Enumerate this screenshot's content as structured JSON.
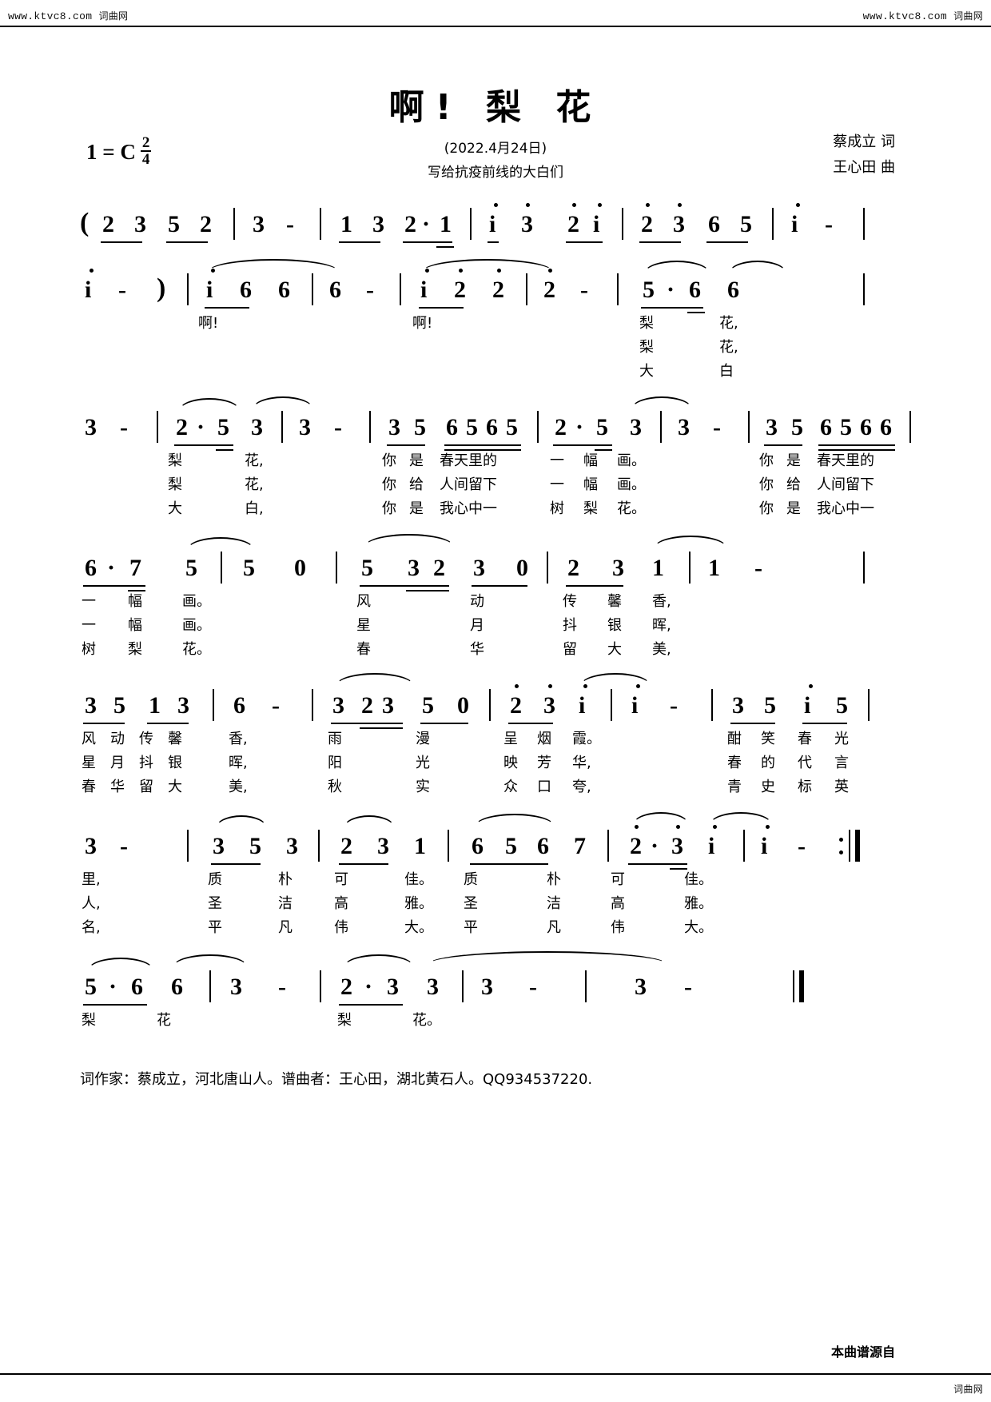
{
  "watermark": {
    "url_left": "www.ktvc8.com",
    "site_left": "词曲网",
    "url_right": "www.ktvc8.com",
    "site_right": "词曲网",
    "bottom_left_url": "",
    "bottom_right": "词曲网"
  },
  "header": {
    "title": "啊! 梨 花",
    "key_label": "1 = C",
    "time_num": "2",
    "time_den": "4",
    "date_line": "(2022.4月24日)",
    "dedication": "写给抗疫前线的大白们",
    "lyricist": "蔡成立 词",
    "composer": "王心田 曲"
  },
  "chart_data": {
    "type": "table",
    "title": "啊! 梨 花 — 简谱 (Numbered Musical Notation)",
    "key": "1 = C",
    "time_signature": "2/4",
    "systems": [
      {
        "index": 1,
        "notes": "( 2 3 5 2 | 3 - | 1 3 2·1 | i 3 2i | 2 3 6 5 | i -",
        "lyrics": []
      },
      {
        "index": 2,
        "notes": "i - ) | i 6 6 | 6 - | i 2 2 | 2 - | 5·6 6",
        "lyrics": [
          "啊!            啊!                   梨      花,",
          "                                      梨      花,",
          "                                      大      白"
        ]
      },
      {
        "index": 3,
        "notes": "3 - | 2·5 3 | 3 - | 3 5 6565 | 2·5 3 | 3 - | 3 5 6566",
        "lyrics": [
          "梨   花,      你 是 春天里的  一 幅 画。      你 是 春天里的",
          "梨   花,      你 给 人间留下  一 幅 画。      你 给 人间留下",
          "大   白,      你 是 我心中一  树 梨 花。      你 是 我心中一"
        ]
      },
      {
        "index": 4,
        "notes": "6·7 5 | 5 0 | 5 32 3 0 | 2 3 1 | 1 -",
        "lyrics": [
          "一 幅 画。      风      动     传 馨 香,",
          "一 幅 画。      星      月     抖 银 晖,",
          "树 梨 花。      春      华     留 大 美,"
        ]
      },
      {
        "index": 5,
        "notes": "3 5 1 3 | 6 - | 3 23 5 0 | 2 3 i | i - | 3 5 i 5",
        "lyrics": [
          "风 动 传 馨 香,   雨   漫   呈 烟 霞。   酣 笑 春 光",
          "星 月 抖 银 晖,   阳   光   映 芳 华,   春 的 代 言",
          "春 华 留 大 美,   秋   实   众 口 夸,   青 史 标 英"
        ]
      },
      {
        "index": 6,
        "notes": "3 - | 3 5 3 | 2 3 1 | 6 5 6 7 | 2·3 i | i - :|",
        "lyrics": [
          "里,   质 朴 可 佳。 质 朴 可 佳。",
          "人,   圣 洁 高 雅。 圣 洁 高 雅。",
          "名,   平 凡 伟 大。 平 凡 伟 大。"
        ]
      },
      {
        "index": 7,
        "notes": "5·6 6 | 3 - | 2·3 3 | 3 - | 3 - ||",
        "lyrics": [
          "梨   花     梨   花。"
        ]
      }
    ]
  },
  "sys1": {
    "n": [
      "(",
      "2",
      "3",
      "5",
      "2",
      "3",
      "-",
      "1",
      "3",
      "2",
      "·",
      "1",
      "i",
      "3",
      "2",
      "i",
      "2",
      "3",
      "6",
      "5",
      "i",
      "-"
    ]
  },
  "sys2": {
    "n": [
      "i",
      "-",
      ")",
      "i",
      "6",
      "6",
      "6",
      "-",
      "i",
      "2",
      "2",
      "2",
      "-",
      "5",
      "·",
      "6",
      "6"
    ],
    "lyr1": [
      "啊!",
      "啊!",
      "梨",
      "花,"
    ],
    "lyr2": [
      "梨",
      "花,"
    ],
    "lyr3": [
      "大",
      "白"
    ]
  },
  "sys3": {
    "n": [
      "3",
      "-",
      "2",
      "·",
      "5",
      "3",
      "3",
      "-",
      "3",
      "5",
      "6",
      "5",
      "6",
      "5",
      "2",
      "·",
      "5",
      "3",
      "3",
      "-",
      "3",
      "5",
      "6",
      "5",
      "6",
      "6"
    ],
    "lyr1": [
      "梨",
      "花,",
      "你",
      "是",
      "春天里的",
      "一",
      "幅",
      "画。",
      "你",
      "是",
      "春天里的"
    ],
    "lyr2": [
      "梨",
      "花,",
      "你",
      "给",
      "人间留下",
      "一",
      "幅",
      "画。",
      "你",
      "给",
      "人间留下"
    ],
    "lyr3": [
      "大",
      "白,",
      "你",
      "是",
      "我心中一",
      "树",
      "梨",
      "花。",
      "你",
      "是",
      "我心中一"
    ]
  },
  "sys4": {
    "n": [
      "6",
      "·",
      "7",
      "5",
      "5",
      "0",
      "5",
      "3",
      "2",
      "3",
      "0",
      "2",
      "3",
      "1",
      "1",
      "-"
    ],
    "lyr1": [
      "一",
      "幅",
      "画。",
      "风",
      "动",
      "传",
      "馨",
      "香,"
    ],
    "lyr2": [
      "一",
      "幅",
      "画。",
      "星",
      "月",
      "抖",
      "银",
      "晖,"
    ],
    "lyr3": [
      "树",
      "梨",
      "花。",
      "春",
      "华",
      "留",
      "大",
      "美,"
    ]
  },
  "sys5": {
    "n": [
      "3",
      "5",
      "1",
      "3",
      "6",
      "-",
      "3",
      "2",
      "3",
      "5",
      "0",
      "2",
      "3",
      "i",
      "i",
      "-",
      "3",
      "5",
      "i",
      "5"
    ],
    "lyr1": [
      "风",
      "动",
      "传",
      "馨",
      "香,",
      "雨",
      "漫",
      "呈",
      "烟",
      "霞。",
      "酣",
      "笑",
      "春",
      "光"
    ],
    "lyr2": [
      "星",
      "月",
      "抖",
      "银",
      "晖,",
      "阳",
      "光",
      "映",
      "芳",
      "华,",
      "春",
      "的",
      "代",
      "言"
    ],
    "lyr3": [
      "春",
      "华",
      "留",
      "大",
      "美,",
      "秋",
      "实",
      "众",
      "口",
      "夸,",
      "青",
      "史",
      "标",
      "英"
    ]
  },
  "sys6": {
    "n": [
      "3",
      "-",
      "3",
      "5",
      "3",
      "2",
      "3",
      "1",
      "6",
      "5",
      "6",
      "7",
      "2",
      "·",
      "3",
      "i",
      "i",
      "-"
    ],
    "lyr1": [
      "里,",
      "质",
      "朴",
      "可",
      "佳。",
      "质",
      "朴",
      "可",
      "佳。"
    ],
    "lyr2": [
      "人,",
      "圣",
      "洁",
      "高",
      "雅。",
      "圣",
      "洁",
      "高",
      "雅。"
    ],
    "lyr3": [
      "名,",
      "平",
      "凡",
      "伟",
      "大。",
      "平",
      "凡",
      "伟",
      "大。"
    ]
  },
  "sys7": {
    "n": [
      "5",
      "·",
      "6",
      "6",
      "3",
      "-",
      "2",
      "·",
      "3",
      "3",
      "3",
      "-",
      "3",
      "-"
    ],
    "lyr1": [
      "梨",
      "花",
      "梨",
      "花。"
    ]
  },
  "footer": {
    "credit_line": "词作家：蔡成立，河北唐山人。谱曲者：王心田，湖北黄石人。QQ934537220.",
    "source": "本曲谱源自"
  }
}
